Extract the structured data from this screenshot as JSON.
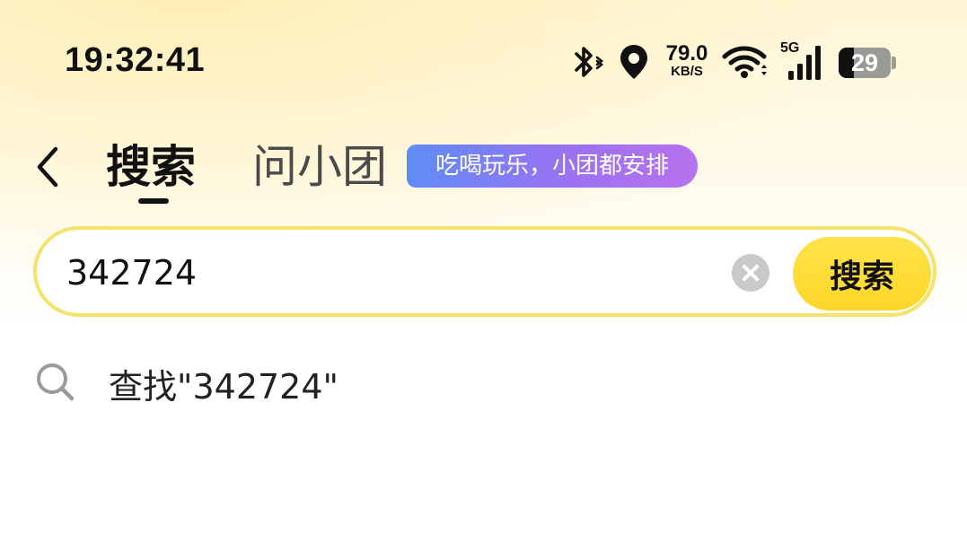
{
  "status_bar": {
    "time": "19:32:41",
    "net_speed": "79.0",
    "net_speed_unit": "KB/S",
    "network_type": "5G",
    "battery_level": "29",
    "battery_fraction": 0.29,
    "icons": [
      "bluetooth-icon",
      "location-icon",
      "wifi-icon",
      "cell-signal-icon",
      "battery-icon"
    ]
  },
  "header": {
    "back_icon": "chevron-left-icon",
    "tabs": [
      {
        "label": "搜索",
        "active": true
      },
      {
        "label": "问小团",
        "active": false
      }
    ],
    "promo_badge": "吃喝玩乐，小团都安排"
  },
  "search": {
    "query": "342724",
    "clear_icon": "clear-icon",
    "button_label": "搜索"
  },
  "suggestions": [
    {
      "icon": "search-icon",
      "text": "查找\"342724\""
    }
  ],
  "colors": {
    "accent_yellow": "#fdd628",
    "search_border": "#f5e26b",
    "badge_gradient_start": "#5f8cf6",
    "badge_gradient_end": "#b872ee"
  }
}
